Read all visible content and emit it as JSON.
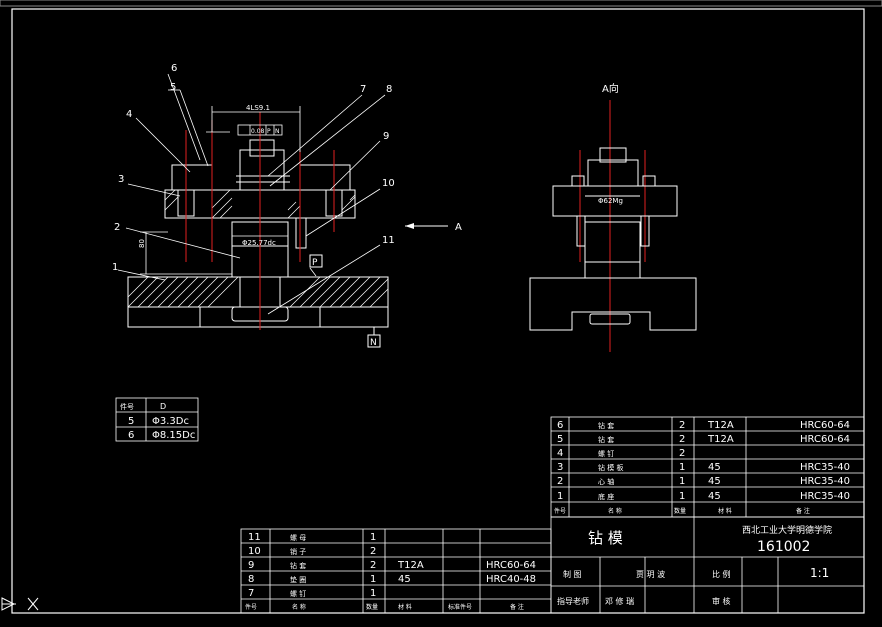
{
  "drawing": {
    "dim_top": "4LS9.1",
    "fcf_tol": "0.08",
    "fcf_d1": "P",
    "fcf_d2": "N",
    "dim_vertical": "80",
    "dim_bushing": "Φ25.77dc",
    "dim_side": "Φ62Mg",
    "datum_p": "P",
    "datum_n": "N",
    "view_arrow_label": "A",
    "section_label": "A向"
  },
  "callouts": [
    "1",
    "2",
    "3",
    "4",
    "5",
    "6",
    "7",
    "8",
    "9",
    "10",
    "11"
  ],
  "small_table": {
    "headers": [
      "件号",
      "D"
    ],
    "rows": [
      [
        "5",
        "Φ3.3Dc"
      ],
      [
        "6",
        "Φ8.15Dc"
      ]
    ]
  },
  "bom_upper": [
    {
      "no": "6",
      "name": "钻 套",
      "qty": "2",
      "mat": "T12A",
      "note": "HRC60-64"
    },
    {
      "no": "5",
      "name": "钻 套",
      "qty": "2",
      "mat": "T12A",
      "note": "HRC60-64"
    },
    {
      "no": "4",
      "name": "螺 钉",
      "qty": "2",
      "mat": "",
      "note": ""
    },
    {
      "no": "3",
      "name": "钻 模 板",
      "qty": "1",
      "mat": "45",
      "note": "HRC35-40"
    },
    {
      "no": "2",
      "name": "心 轴",
      "qty": "1",
      "mat": "45",
      "note": "HRC35-40"
    },
    {
      "no": "1",
      "name": "底 座",
      "qty": "1",
      "mat": "45",
      "note": "HRC35-40"
    }
  ],
  "bom_upper_header": [
    "件号",
    "名 称",
    "数量",
    "材 料",
    "备 注"
  ],
  "bom_lower": [
    {
      "no": "11",
      "name": "螺 母",
      "qty": "1",
      "mat": "",
      "note": ""
    },
    {
      "no": "10",
      "name": "销 子",
      "qty": "2",
      "mat": "",
      "note": ""
    },
    {
      "no": "9",
      "name": "钻 套",
      "qty": "2",
      "mat": "T12A",
      "note": "HRC60-64"
    },
    {
      "no": "8",
      "name": "垫 圈",
      "qty": "1",
      "mat": "45",
      "note": "HRC40-48"
    },
    {
      "no": "7",
      "name": "螺 钉",
      "qty": "1",
      "mat": "",
      "note": ""
    }
  ],
  "bom_lower_header": [
    "件号",
    "名 称",
    "数量",
    "材 料",
    "标准件号",
    "备 注"
  ],
  "title_block": {
    "part_name": "钻  模",
    "school": "西北工业大学明德学院",
    "drawing_no": "161002",
    "drawn_label": "制 图",
    "drawn_name": "贾 玥 波",
    "scale_label": "比 例",
    "scale_value": "1:1",
    "advisor_label": "指导老师",
    "advisor_name": "邓 修 瑞",
    "review_label": "审 核"
  }
}
